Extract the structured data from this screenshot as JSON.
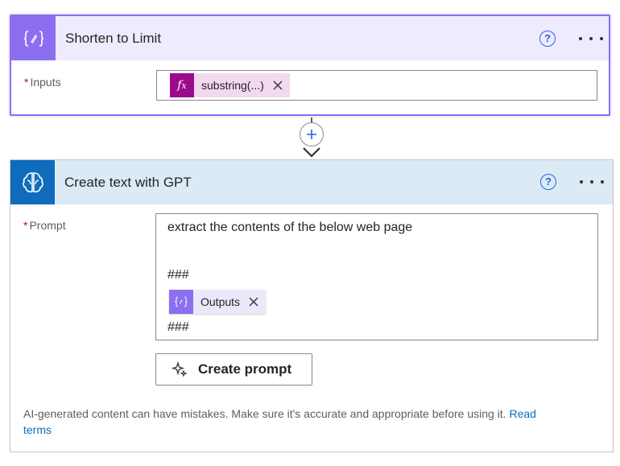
{
  "card1": {
    "title": "Shorten to Limit",
    "icon": "expression-icon",
    "field_label": "Inputs",
    "required_mark": "*",
    "token": {
      "label": "substring(...)",
      "icon": "fx-icon"
    }
  },
  "connector": {
    "add_symbol": "+"
  },
  "card2": {
    "title": "Create text with GPT",
    "icon": "gpt-brain-icon",
    "field_label": "Prompt",
    "required_mark": "*",
    "prompt_line1": "extract the contents of the below web page",
    "prompt_sep1": "###",
    "token": {
      "label": "Outputs",
      "icon": "expression-icon"
    },
    "prompt_sep2": "###",
    "create_prompt_label": "Create prompt",
    "disclaimer_text": "AI-generated content can have mistakes. Make sure it's accurate and appropriate before using it. ",
    "disclaimer_link_1": "Read",
    "disclaimer_link_2": "terms"
  },
  "header_actions": {
    "help_symbol": "?"
  },
  "colors": {
    "card1_accent": "#8c6ff0",
    "card2_accent": "#0f6cbd",
    "fx_token": "#9b0a8b",
    "link": "#0f6cbd",
    "required": "#c50f1f"
  }
}
